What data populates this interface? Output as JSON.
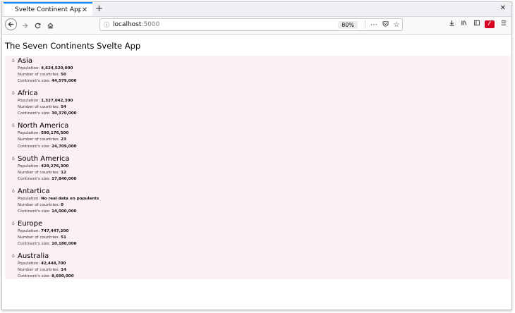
{
  "browser": {
    "tab_title": "Svelte Continent App",
    "tab_close": "✕",
    "new_tab": "+",
    "window_close": "✕",
    "url_host": "localhost",
    "url_port": ":5000",
    "zoom": "80%"
  },
  "page": {
    "title": "The Seven Continents Svelte App",
    "labels": {
      "population": "Population:",
      "countries": "Number of countries:",
      "size": "Continent's size:"
    },
    "continents": [
      {
        "name": "Asia",
        "population": "4,624,520,000",
        "countries": "50",
        "size": "44,579,000"
      },
      {
        "name": "Africa",
        "population": "1,327,042,300",
        "countries": "54",
        "size": "30,370,000"
      },
      {
        "name": "North America",
        "population": "590,176,500",
        "countries": "23",
        "size": "24,709,000"
      },
      {
        "name": "South America",
        "population": "429,276,300",
        "countries": "12",
        "size": "17,840,000"
      },
      {
        "name": "Antartica",
        "population": "No real data on populants",
        "countries": "0",
        "size": "14,000,000"
      },
      {
        "name": "Europe",
        "population": "747,447,200",
        "countries": "51",
        "size": "10,180,000"
      },
      {
        "name": "Australia",
        "population": "42,448,700",
        "countries": "14",
        "size": "8,600,000"
      }
    ]
  }
}
